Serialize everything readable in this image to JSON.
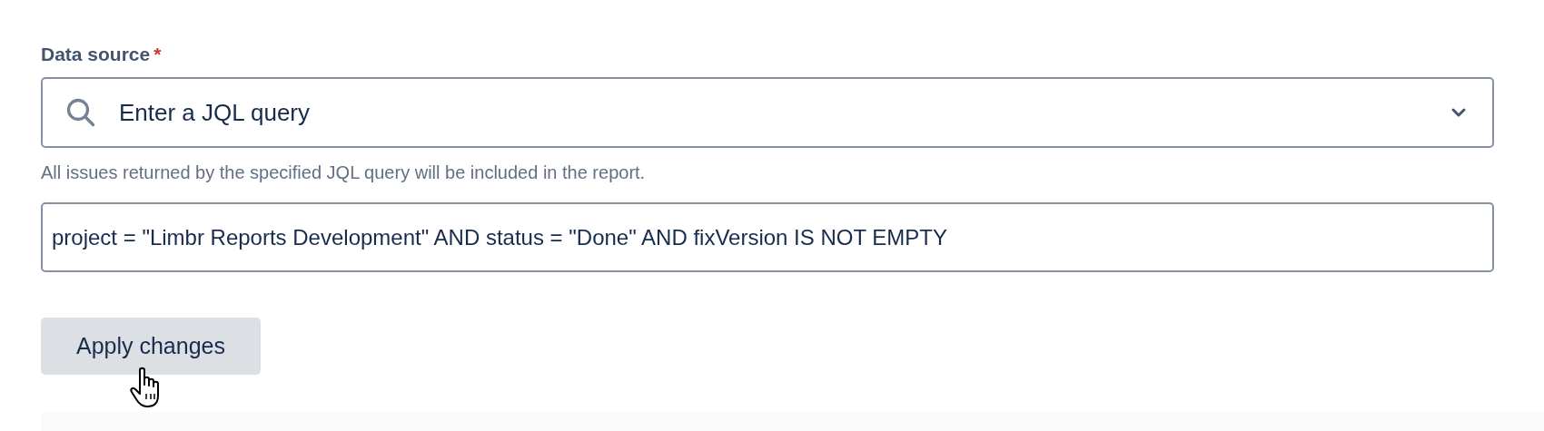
{
  "field": {
    "label": "Data source",
    "required": true,
    "required_mark": "*"
  },
  "source_select": {
    "value": "Enter a JQL query"
  },
  "help_text": "All issues returned by the specified JQL query will be included in the report.",
  "query_field": {
    "value": "project = \"Limbr Reports Development\" AND status = \"Done\" AND fixVersion IS NOT EMPTY"
  },
  "apply_button": {
    "label": "Apply changes"
  }
}
